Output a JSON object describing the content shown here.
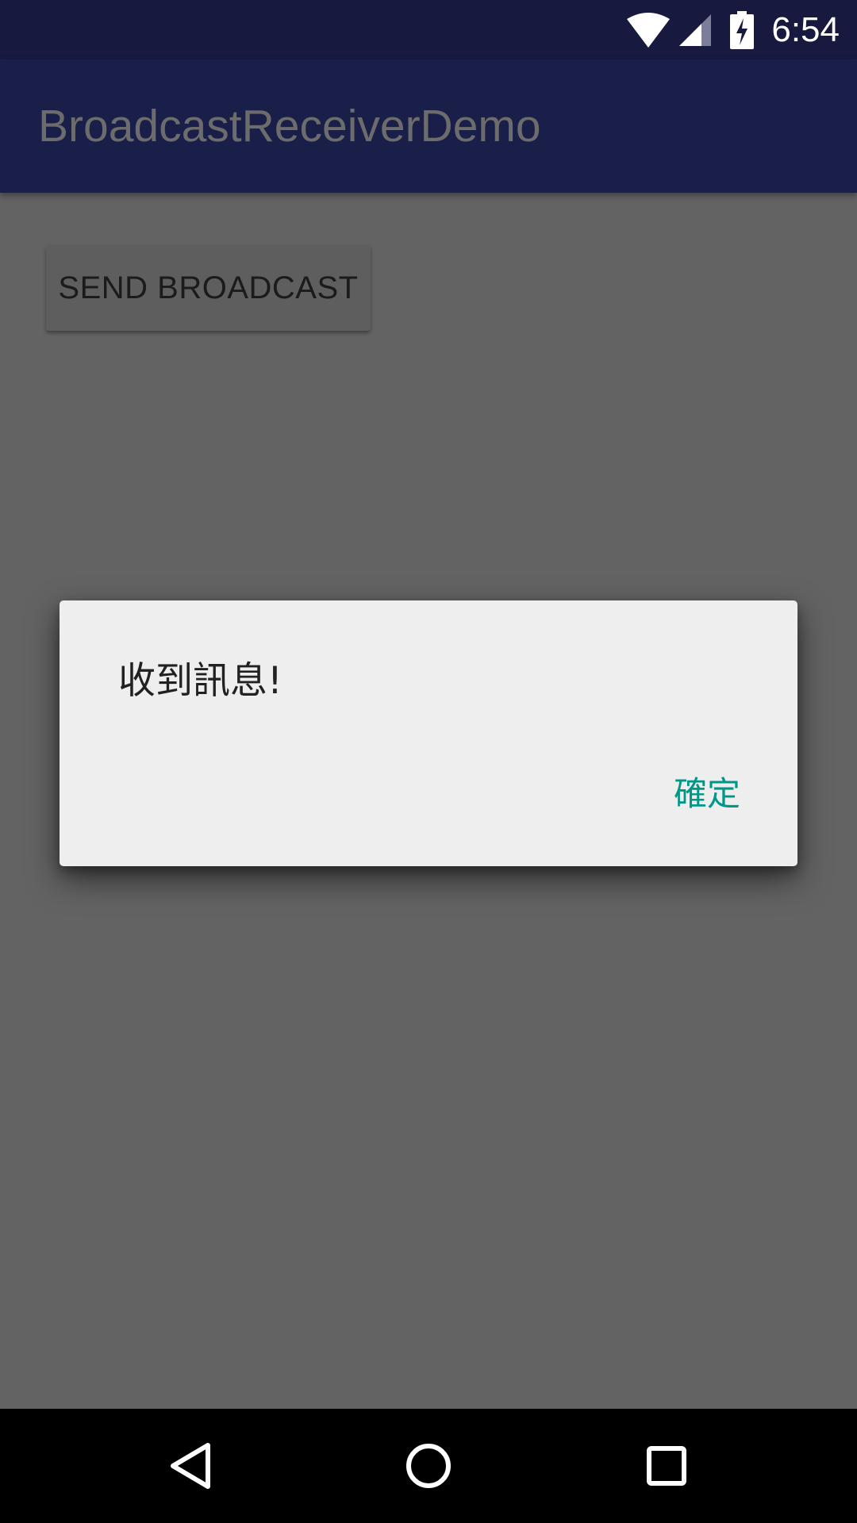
{
  "status_bar": {
    "time": "6:54",
    "icons": [
      "wifi-icon",
      "cell-signal-icon",
      "battery-charging-icon"
    ]
  },
  "app_bar": {
    "title": "BroadcastReceiverDemo"
  },
  "content": {
    "send_button_label": "SEND BROADCAST"
  },
  "dialog": {
    "message": "收到訊息!",
    "ok_label": "確定"
  },
  "nav_bar": {
    "icons": [
      "back-icon",
      "home-icon",
      "recents-icon"
    ]
  },
  "colors": {
    "status_bar": "#17193f",
    "app_bar": "#1a1f4a",
    "scrim_background": "#636363",
    "dialog_background": "#eeeeee",
    "accent": "#009688"
  }
}
